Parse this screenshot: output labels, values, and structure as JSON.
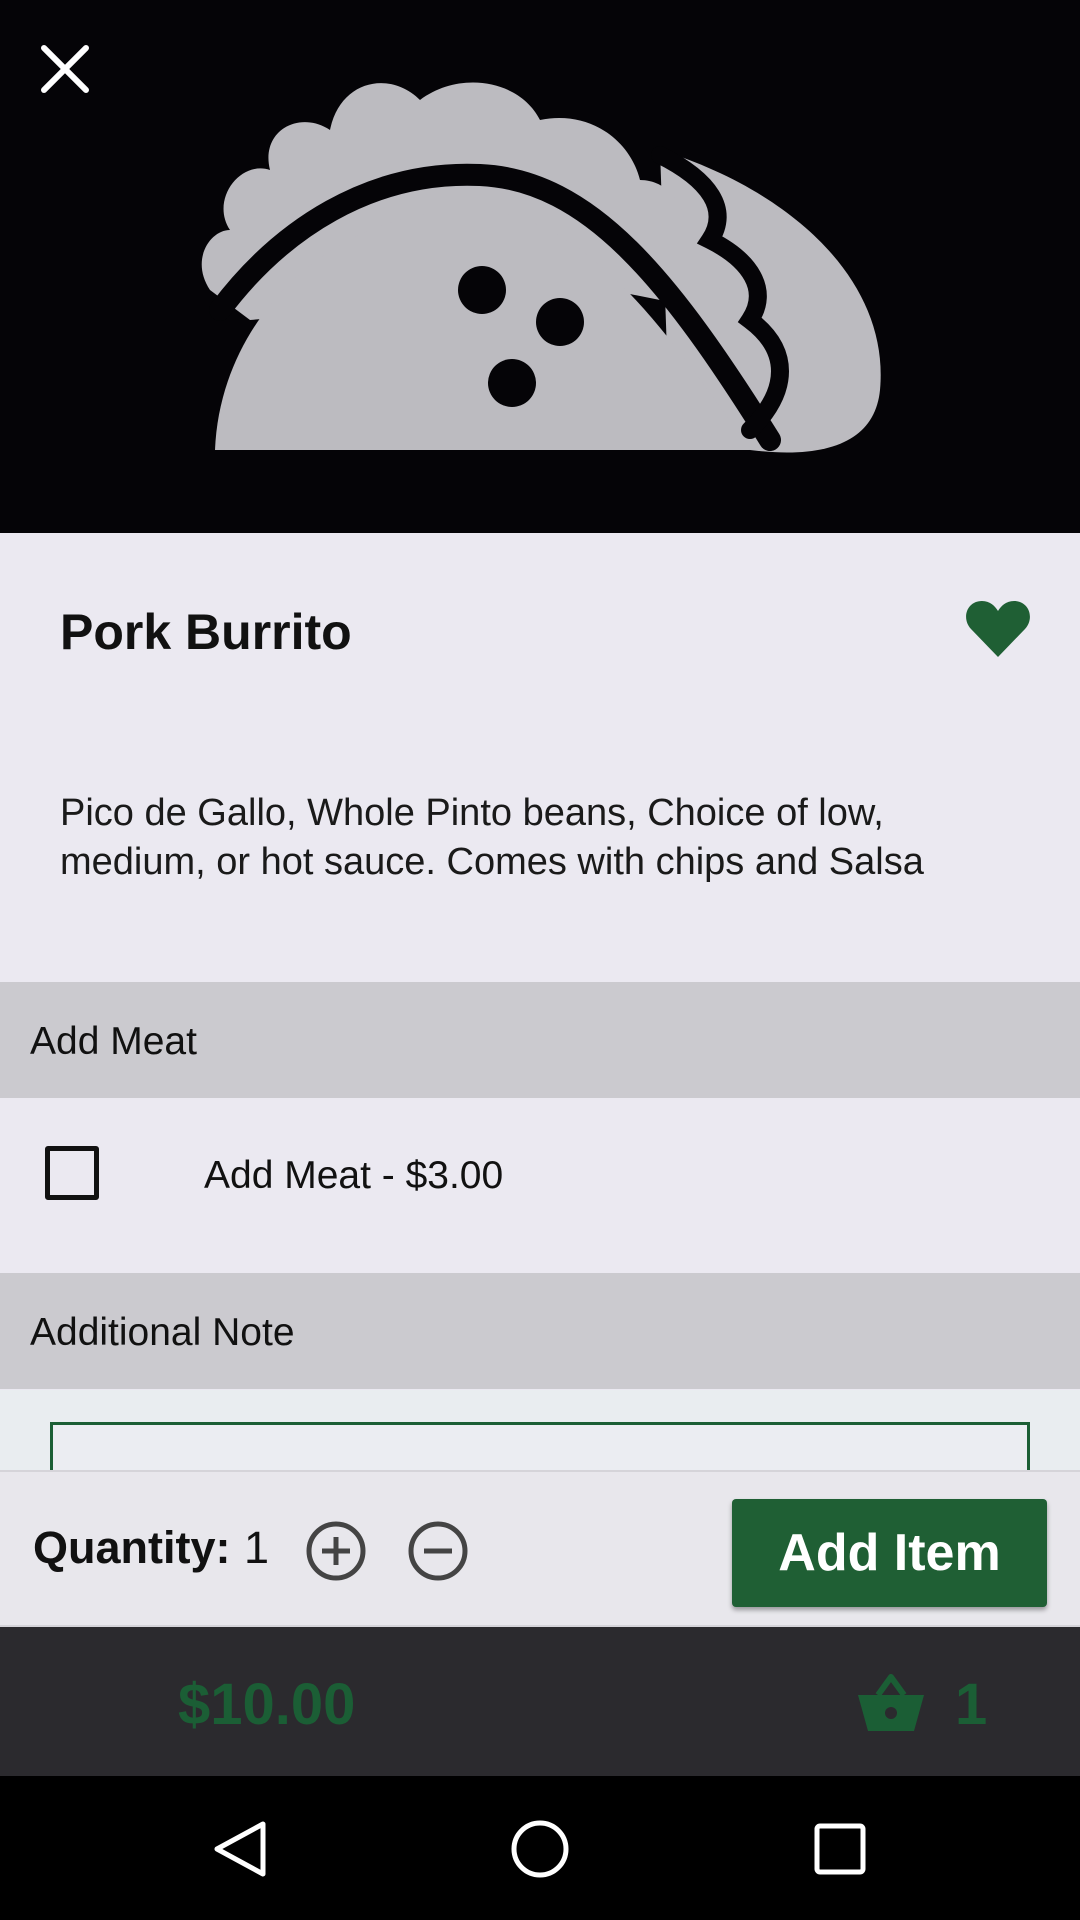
{
  "item": {
    "title": "Pork Burrito",
    "description": "Pico de Gallo, Whole Pinto beans, Choice of low, medium, or hot sauce. Comes with chips and Salsa",
    "favorited": true
  },
  "sections": {
    "meat_header": "Add Meat",
    "meat_option_label": "Add Meat - $3.00",
    "meat_option_checked": false,
    "note_header": "Additional Note",
    "note_value": ""
  },
  "quantity": {
    "label": "Quantity:",
    "value": "1"
  },
  "actions": {
    "add_item_label": "Add Item"
  },
  "footer": {
    "total": "$10.00",
    "cart_count": "1"
  },
  "icons": {
    "close": "close-icon",
    "hero": "taco-icon",
    "favorite": "heart-icon",
    "plus": "plus-circle-icon",
    "minus": "minus-circle-icon",
    "cart": "basket-icon",
    "nav_back": "back-triangle-icon",
    "nav_home": "home-circle-icon",
    "nav_recents": "recents-square-icon"
  },
  "colors": {
    "brand_green": "#1f5f34",
    "hero_bg": "#050407",
    "sheet_bg": "#ebe9f1",
    "section_bg": "#cbcacf",
    "footer_bg": "#2b2a2e"
  }
}
